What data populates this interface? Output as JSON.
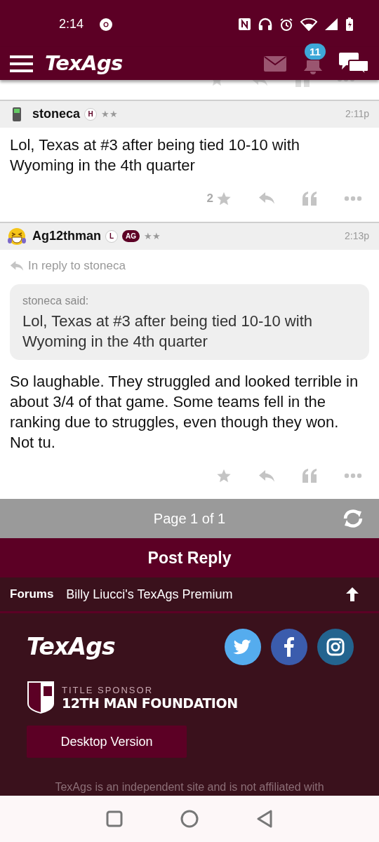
{
  "status_bar": {
    "time": "2:14"
  },
  "header": {
    "logo": "TexAgs",
    "notification_count": "11"
  },
  "posts": [
    {
      "username": "stoneca",
      "avatar": {
        "kind": "phone"
      },
      "badges": [
        {
          "label": "H",
          "kind": "outline"
        }
      ],
      "stars": "★★",
      "time": "2:11p",
      "body": "Lol, Texas at #3 after being tied 10-10 with Wyoming in the 4th quarter",
      "rating_count": "2"
    },
    {
      "username": "Ag12thman",
      "avatar": {
        "kind": "laugh"
      },
      "badges": [
        {
          "label": "L",
          "kind": "outline"
        },
        {
          "label": "AG",
          "kind": "filled"
        }
      ],
      "stars": "★★",
      "time": "2:13p",
      "in_reply_to": "In reply to stoneca",
      "quote": {
        "author_line": "stoneca said:",
        "text": "Lol, Texas at #3 after being tied 10-10 with Wyoming in the 4th quarter"
      },
      "body": "So laughable. They struggled and looked terrible in about 3/4 of that game. Some teams fell in the ranking due to struggles, even though they won. Not tu."
    }
  ],
  "pagination": {
    "label": "Page 1 of 1"
  },
  "post_reply": "Post Reply",
  "breadcrumb": [
    {
      "label": "Forums",
      "kind": "root"
    },
    {
      "label": "Billy Liucci's TexAgs Premium",
      "kind": "current"
    }
  ],
  "footer": {
    "logo": "TexAgs",
    "sponsor_label": "TITLE SPONSOR",
    "sponsor_name": "12TH MAN FOUNDATION",
    "desktop_button": "Desktop Version",
    "disclaimer": "TexAgs is an independent site and is not affiliated with"
  }
}
